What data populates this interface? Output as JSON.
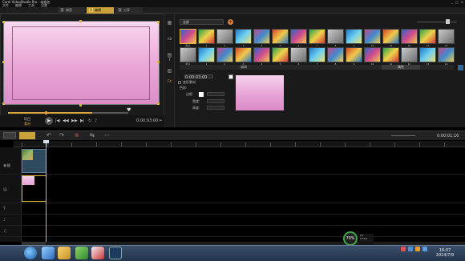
{
  "app": {
    "title": "Corel VideoStudio Pro - 未命名",
    "window_controls": [
      "_",
      "□",
      "×"
    ],
    "menu": [
      "文件",
      "编辑",
      "工具",
      "设置"
    ]
  },
  "steps": [
    {
      "num": "1",
      "label": "捕获"
    },
    {
      "num": "2",
      "label": "编辑"
    },
    {
      "num": "3",
      "label": "分享"
    }
  ],
  "preview": {
    "controls": {
      "project_label": "项目",
      "clip_label": "素材",
      "play_icon": "▶",
      "prev_icon": "|◀",
      "rewind_icon": "◀◀",
      "next_icon": "▶▶",
      "end_icon": "▶|",
      "repeat_icon": "↻",
      "volume_icon": "♪",
      "split_icon": "✂"
    },
    "marker_icon": "♥"
  },
  "library": {
    "dropdown": "全部",
    "add_icon": "+",
    "side_icons": [
      "▦",
      "AB",
      "▤",
      "T",
      "▧",
      "FX"
    ],
    "row1_labels": [
      "默认",
      "1",
      "2",
      "3",
      "4",
      "5",
      "6",
      "7",
      "8",
      "9",
      "10",
      "11",
      "12",
      "13",
      "14"
    ],
    "row2_labels": [
      "默认",
      "1",
      "2",
      "3",
      "4",
      "5",
      "6",
      "7",
      "8",
      "9",
      "10",
      "11",
      "12",
      "13",
      "14"
    ],
    "tabs": {
      "edit": "编辑",
      "attr": "属性"
    },
    "gear_icon": "⚙"
  },
  "options": {
    "duration": "0:00:03:00",
    "color_label": "色彩:",
    "check_label": "变形素材",
    "row1": "色彩:",
    "row2": "边框:",
    "row3": "宽度:",
    "row4": "高度:"
  },
  "timeline": {
    "timecode": "0:00:01:16",
    "tools": [
      "↶",
      "↷",
      "⊕",
      "⇆",
      "⋯"
    ],
    "track_icons": [
      "◉▦",
      "▤",
      "T",
      "♪",
      "♫"
    ]
  },
  "overlay": {
    "cpu": "70%",
    "info": [
      "OK",
      "0.5K/s"
    ]
  },
  "taskbar": {
    "clock_time": "16:07",
    "clock_date": "2014/7/9",
    "tray_icons": [
      "network",
      "volume",
      "flag",
      "app"
    ]
  },
  "colors": {
    "accent": "#c9a23b",
    "canvas_top": "#f8d7ee",
    "canvas_bottom": "#dc8dc8",
    "playhead": "#9bbfe0"
  }
}
